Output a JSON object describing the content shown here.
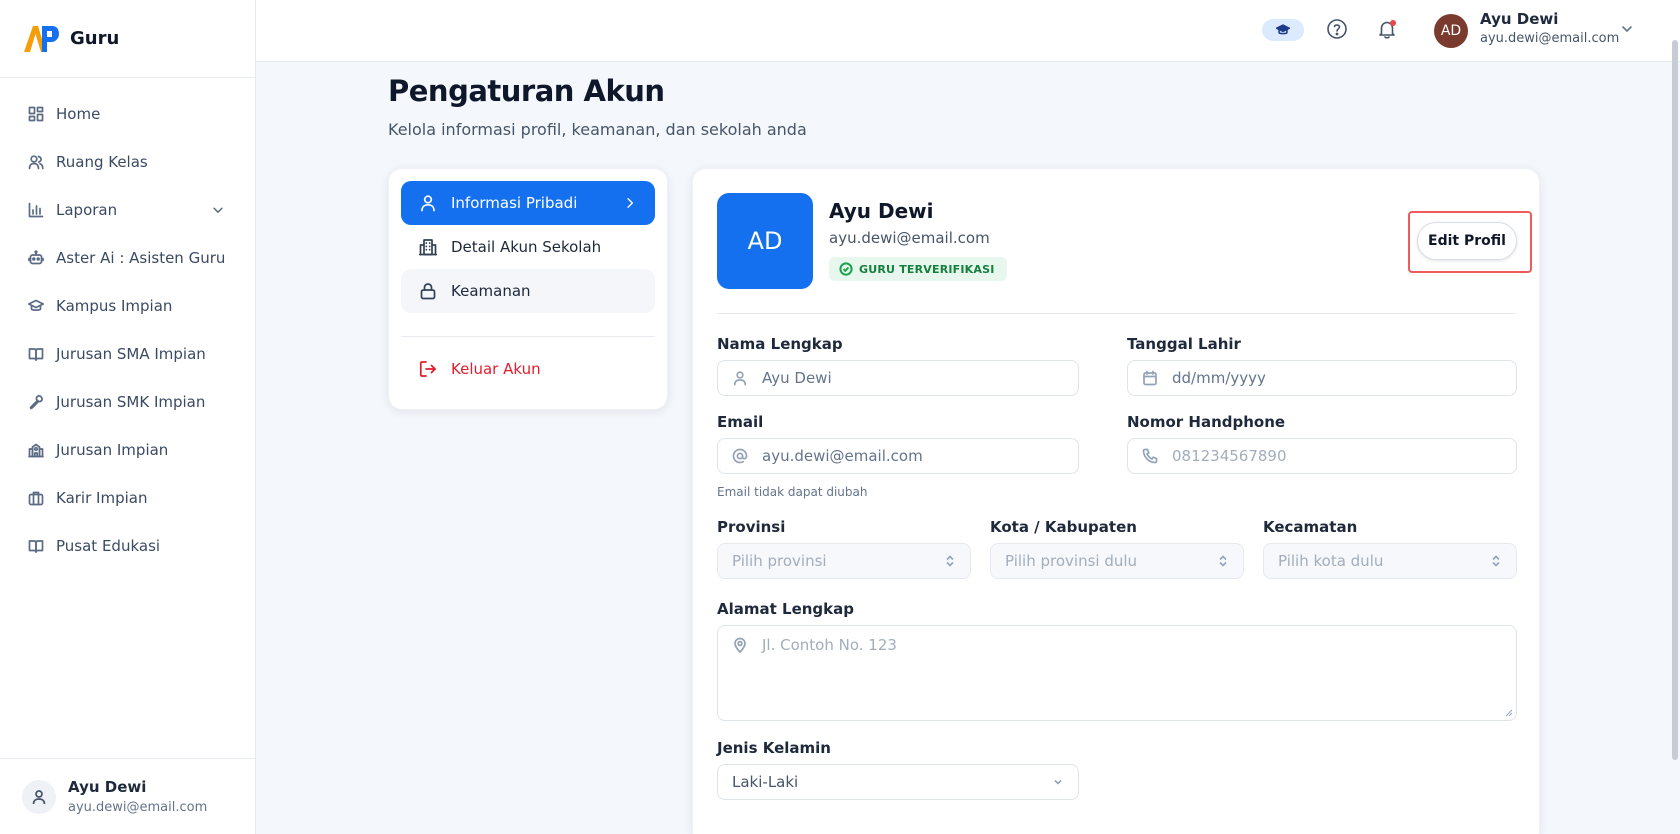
{
  "brand": {
    "name": "Guru",
    "logo_text": "AP"
  },
  "sidebar": {
    "items": [
      {
        "label": "Home",
        "icon": "grid-icon"
      },
      {
        "label": "Ruang Kelas",
        "icon": "users-icon"
      },
      {
        "label": "Laporan",
        "icon": "bar-chart-icon"
      },
      {
        "label": "Aster Ai : Asisten Guru",
        "icon": "robot-icon"
      },
      {
        "label": "Kampus Impian",
        "icon": "graduation-cap-icon"
      },
      {
        "label": "Jurusan SMA Impian",
        "icon": "book-open-icon"
      },
      {
        "label": "Jurusan SMK Impian",
        "icon": "wrench-icon"
      },
      {
        "label": "Jurusan Impian",
        "icon": "school-icon"
      },
      {
        "label": "Karir Impian",
        "icon": "briefcase-icon"
      },
      {
        "label": "Pusat Edukasi",
        "icon": "book-icon"
      }
    ],
    "footer": {
      "name": "Ayu Dewi",
      "email": "ayu.dewi@email.com"
    }
  },
  "topbar": {
    "avatar_initials": "AD",
    "name": "Ayu Dewi",
    "email": "ayu.dewi@email.com"
  },
  "page": {
    "title": "Pengaturan Akun",
    "subtitle": "Kelola informasi profil, keamanan, dan sekolah anda"
  },
  "menu": {
    "items": [
      {
        "label": "Informasi Pribadi"
      },
      {
        "label": "Detail Akun Sekolah"
      },
      {
        "label": "Keamanan"
      }
    ],
    "logout": "Keluar Akun"
  },
  "profile": {
    "initials": "AD",
    "name": "Ayu Dewi",
    "email": "ayu.dewi@email.com",
    "badge": "GURU TERVERIFIKASI",
    "edit_label": "Edit Profil"
  },
  "form": {
    "nama": {
      "label": "Nama Lengkap",
      "value": "Ayu Dewi"
    },
    "tanggal": {
      "label": "Tanggal Lahir",
      "value": "dd/mm/yyyy"
    },
    "email": {
      "label": "Email",
      "value": "ayu.dewi@email.com",
      "hint": "Email tidak dapat diubah"
    },
    "phone": {
      "label": "Nomor Handphone",
      "placeholder": "081234567890"
    },
    "provinsi": {
      "label": "Provinsi",
      "placeholder": "Pilih provinsi"
    },
    "kota": {
      "label": "Kota / Kabupaten",
      "placeholder": "Pilih provinsi dulu"
    },
    "kecamatan": {
      "label": "Kecamatan",
      "placeholder": "Pilih kota dulu"
    },
    "alamat": {
      "label": "Alamat Lengkap",
      "placeholder": "Jl. Contoh No. 123"
    },
    "gender": {
      "label": "Jenis Kelamin",
      "value": "Laki-Laki"
    }
  },
  "colors": {
    "primary": "#1570ef",
    "danger": "#e11d2e",
    "verified": "#15803d",
    "highlight": "#ef5b5b"
  }
}
